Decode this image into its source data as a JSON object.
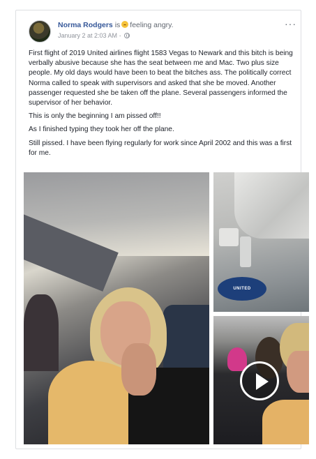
{
  "post": {
    "author": "Norma Rodgers",
    "activity_prefix": "is",
    "activity": "feeling angry.",
    "timestamp": "January 2 at 2:03 AM",
    "more_icon": "···",
    "paragraphs": [
      "First flight of 2019 United airlines flight 1583 Vegas to Newark and this bitch is being verbally abusive because she has the seat between me and Mac. Two plus size people. My old days would have been to beat the bitches ass. The politically correct Norma called to speak with supervisors and asked that she be moved. Another passenger requested she be taken off the plane. Several passengers informed the supervisor of her behavior.",
      "This is only the beginning I am pissed off!!",
      "As I finished typing they took her off the plane.",
      "Still pissed. I have been flying regularly for work since April 2002 and this was a first for me."
    ],
    "media_logo_text": "UNITED",
    "icons": {
      "avatar": "avatar",
      "emoji": "angry-emoji-icon",
      "privacy": "globe-icon",
      "play": "play-icon"
    },
    "colors": {
      "author": "#365899",
      "meta": "#90949c",
      "text": "#1d2129"
    }
  }
}
